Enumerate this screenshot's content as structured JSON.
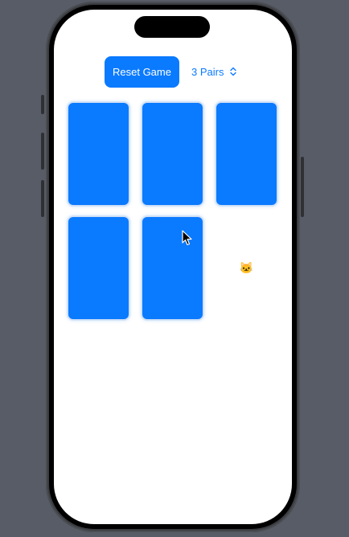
{
  "toolbar": {
    "reset_label": "Reset Game",
    "pairs_value": "3 Pairs"
  },
  "cards": [
    {
      "face_up": false,
      "emoji": ""
    },
    {
      "face_up": false,
      "emoji": ""
    },
    {
      "face_up": false,
      "emoji": ""
    },
    {
      "face_up": false,
      "emoji": ""
    },
    {
      "face_up": false,
      "emoji": ""
    },
    {
      "face_up": true,
      "emoji": "🐱"
    }
  ],
  "colors": {
    "accent": "#0a7aff",
    "background": "#575c66",
    "screen": "#ffffff"
  },
  "icons": {
    "pairs_chevron": "chevron-up-down-icon",
    "pointer": "cursor-arrow-icon"
  }
}
